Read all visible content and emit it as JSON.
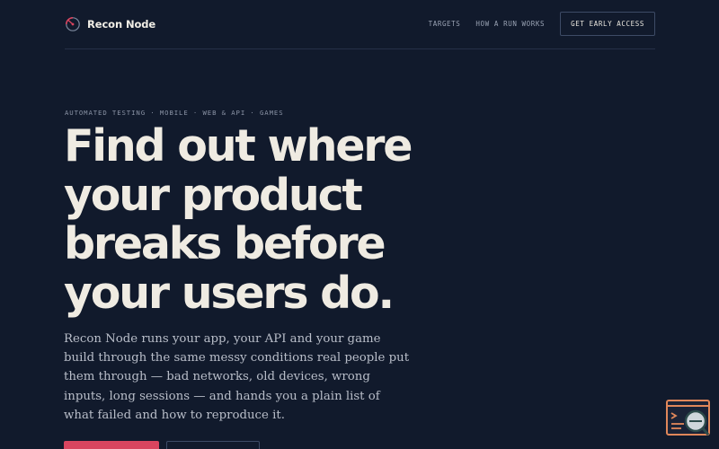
{
  "brand": {
    "name": "Recon Node",
    "logo_icon": "radar-logo-icon"
  },
  "nav": {
    "links": [
      "TARGETS",
      "HOW A RUN WORKS"
    ],
    "cta_label": "GET EARLY ACCESS"
  },
  "hero": {
    "eyebrow": "AUTOMATED TESTING · MOBILE · WEB & API · GAMES",
    "headline_lines": [
      "Find out where",
      "your product",
      "breaks before",
      "your users do."
    ],
    "body": "Recon Node runs your app, your API and your game build through the same messy conditions real people put them through — bad networks, old devices, wrong inputs, long sessions — and hands you a plain list of what failed and how to reproduce it."
  },
  "colors": {
    "background": "#111a2c",
    "accent": "#d9455f",
    "text": "#efebe2",
    "muted": "#b9bec9",
    "widget": "#e0875a"
  },
  "widget": {
    "icon": "terminal-search-icon"
  }
}
